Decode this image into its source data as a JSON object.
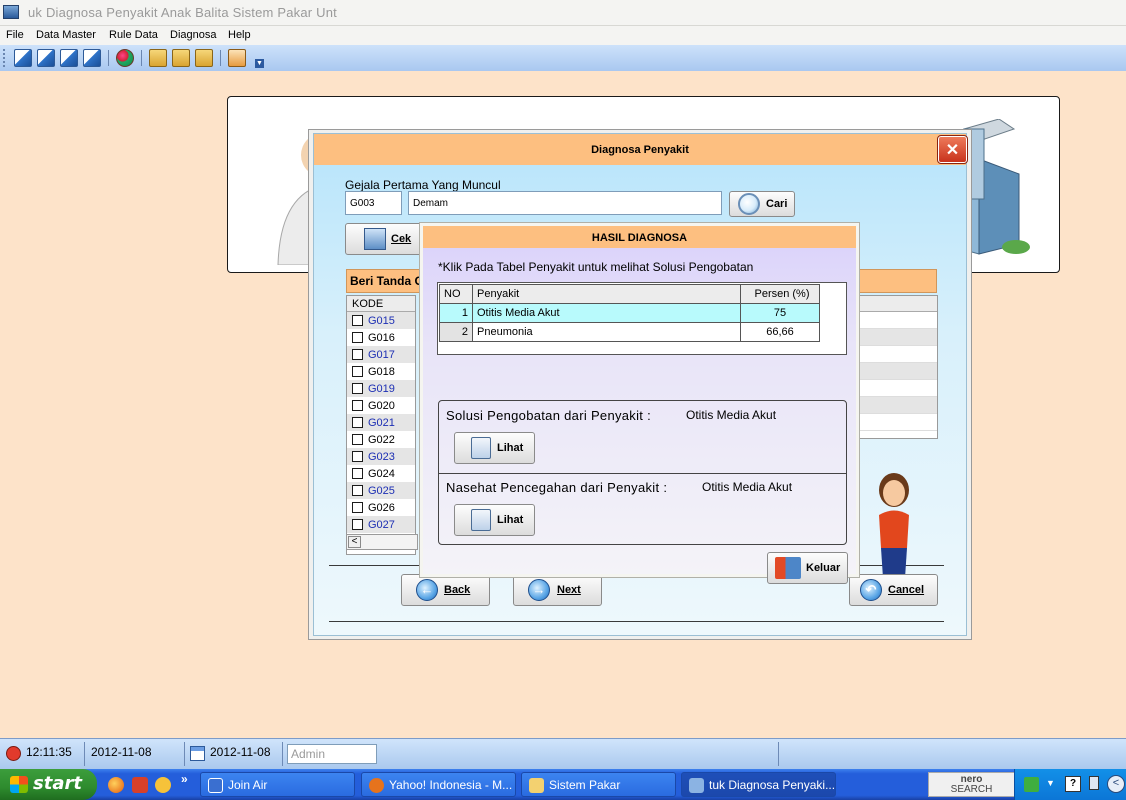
{
  "app": {
    "title": "uk Diagnosa Penyakit Anak Balita  Sistem Pakar Unt",
    "menu": [
      "File",
      "Data Master",
      "Rule Data",
      "Diagnosa",
      "Help"
    ]
  },
  "diagnosa_window": {
    "title": "Diagnosa Penyakit",
    "close_label": "✕",
    "gejala_label": "Gejala Pertama Yang Muncul",
    "gejala_code": "G003",
    "gejala_name": "Demam",
    "cari_label": "Cari",
    "cek_label": "Cek",
    "beri_tanda_label": "Beri Tanda C",
    "kode_header": "KODE",
    "codes": [
      "G015",
      "G016",
      "G017",
      "G018",
      "G019",
      "G020",
      "G021",
      "G022",
      "G023",
      "G024",
      "G025",
      "G026",
      "G027"
    ],
    "back_label": "Back",
    "next_label": "Next",
    "cancel_label": "Cancel"
  },
  "hasil_diagnosa": {
    "title": "HASIL DIAGNOSA",
    "note": "*Klik Pada Tabel Penyakit untuk melihat Solusi Pengobatan",
    "columns": [
      "NO",
      "Penyakit",
      "Persen (%)"
    ],
    "rows": [
      {
        "no": "1",
        "penyakit": "Otitis Media Akut",
        "persen": "75"
      },
      {
        "no": "2",
        "penyakit": "Pneumonia",
        "persen": "66,66"
      }
    ],
    "solusi_label": "Solusi Pengobatan dari Penyakit :",
    "solusi_value": "Otitis Media Akut",
    "nasehat_label": "Nasehat Pencegahan dari Penyakit :",
    "nasehat_value": "Otitis Media Akut",
    "lihat_label": "Lihat",
    "keluar_label": "Keluar"
  },
  "statusbar": {
    "time": "12:11:35",
    "date1": "2012-11-08",
    "date2": "2012-11-08",
    "user": "Admin"
  },
  "taskbar": {
    "start_label": "start",
    "tasks": [
      "Join Air",
      "Yahoo! Indonesia - M...",
      "Sistem Pakar",
      "tuk Diagnosa Penyaki..."
    ],
    "nero_label": "nero",
    "nero_sub": "SEARCH"
  },
  "colors": {
    "accent_orange": "#fdbf80",
    "desktop_bg": "#fde3c9",
    "xp_blue": "#245edb",
    "selected_row": "#b8fafc"
  }
}
